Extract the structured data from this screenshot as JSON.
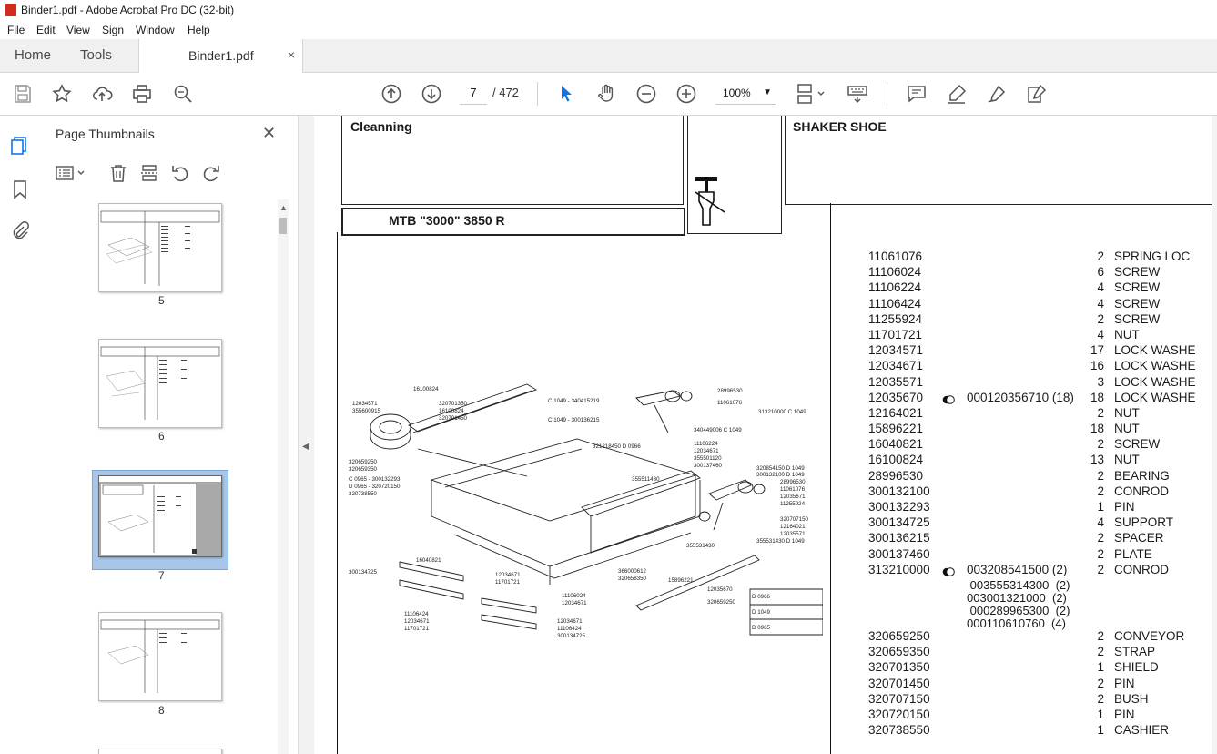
{
  "window": {
    "title": "Binder1.pdf - Adobe Acrobat Pro DC (32-bit)"
  },
  "menu": [
    "File",
    "Edit",
    "View",
    "Sign",
    "Window",
    "Help"
  ],
  "tabs": {
    "home": "Home",
    "tools": "Tools",
    "doc": "Binder1.pdf",
    "close": "×"
  },
  "toolbar": {
    "page_current": "7",
    "page_total": "/ 472",
    "zoom": "100%"
  },
  "sidebar": {
    "title": "Page Thumbnails",
    "thumbnails": [
      {
        "label": "5"
      },
      {
        "label": "6"
      },
      {
        "label": "7"
      },
      {
        "label": "8"
      }
    ],
    "selected_page": "7"
  },
  "document": {
    "section_title": "Cleanning",
    "model": "MTB \"3000\" 3850 R",
    "group_title": "SHAKER SHOE",
    "parts": [
      {
        "pn": "11061076",
        "qty": "2",
        "desc": "SPRING LOC"
      },
      {
        "pn": "11106024",
        "qty": "6",
        "desc": "SCREW"
      },
      {
        "pn": "11106224",
        "qty": "4",
        "desc": "SCREW"
      },
      {
        "pn": "11106424",
        "qty": "4",
        "desc": "SCREW"
      },
      {
        "pn": "11255924",
        "qty": "2",
        "desc": "SCREW"
      },
      {
        "pn": "11701721",
        "qty": "4",
        "desc": "NUT"
      },
      {
        "pn": "12034571",
        "qty": "17",
        "desc": "LOCK WASHE"
      },
      {
        "pn": "12034671",
        "qty": "16",
        "desc": "LOCK WASHE"
      },
      {
        "pn": "12035571",
        "qty": "3",
        "desc": "LOCK WASHE"
      },
      {
        "pn": "12035670",
        "alt": "000120356710  (18)",
        "qty": "18",
        "desc": "LOCK WASHE"
      },
      {
        "pn": "12164021",
        "qty": "2",
        "desc": "NUT"
      },
      {
        "pn": "15896221",
        "qty": "18",
        "desc": "NUT"
      },
      {
        "pn": "16040821",
        "qty": "2",
        "desc": "SCREW"
      },
      {
        "pn": "16100824",
        "qty": "13",
        "desc": "NUT"
      },
      {
        "pn": "28996530",
        "qty": "2",
        "desc": "BEARING"
      },
      {
        "pn": "300132100",
        "qty": "2",
        "desc": "CONROD"
      },
      {
        "pn": "300132293",
        "qty": "1",
        "desc": "PIN"
      },
      {
        "pn": "300134725",
        "qty": "4",
        "desc": "SUPPORT"
      },
      {
        "pn": "300136215",
        "qty": "2",
        "desc": "SPACER"
      },
      {
        "pn": "300137460",
        "qty": "2",
        "desc": "PLATE"
      },
      {
        "pn": "313210000",
        "alt": "003208541500  (2)",
        "qty": "2",
        "desc": "CONROD"
      }
    ],
    "alternates": [
      " 003555314300  (2)",
      "003001321000  (2)",
      " 000289965300  (2)",
      "000110610760  (4)"
    ],
    "parts2": [
      {
        "pn": "320659250",
        "qty": "2",
        "desc": "CONVEYOR"
      },
      {
        "pn": "320659350",
        "qty": "2",
        "desc": "STRAP"
      },
      {
        "pn": "320701350",
        "qty": "1",
        "desc": "SHIELD"
      },
      {
        "pn": "320701450",
        "qty": "2",
        "desc": "PIN"
      },
      {
        "pn": "320707150",
        "qty": "2",
        "desc": "BUSH"
      },
      {
        "pn": "320720150",
        "qty": "1",
        "desc": "PIN"
      },
      {
        "pn": "320738550",
        "qty": "1",
        "desc": "CASHIER"
      }
    ],
    "diagram_labels": {
      "a": "16100824",
      "b": "12034571",
      "c": "355600915",
      "d": "320701350",
      "e": "16100824",
      "f": "320701450",
      "g": "C 1049 - 340415219",
      "h": "C 1049 - 300136215",
      "i": "28996530",
      "j": "11061076",
      "k": "313210000 C 1049",
      "l": "340449006 C 1049",
      "m": "320659250",
      "n": "320659350",
      "o": "C 0965 - 300132293",
      "p": "D 0965 - 320720150",
      "q": "320738550",
      "r": "321218450 D 0966",
      "s": "11106224",
      "t": "12034671",
      "u": "355501120",
      "v": "300137460",
      "w": "355511430",
      "x": "320854150 D 1049",
      "y": "300132100 D 1049",
      "z": "28996530",
      "a2": "11061076",
      "b2": "12035671",
      "c2": "11255924",
      "d2": "320707150",
      "e2": "12164021",
      "f2": "12035571",
      "g2": "355531430 D 1049",
      "h2": "355531430",
      "i2": "16040821",
      "j2": "300134725",
      "k2": "12034671",
      "l2": "11701721",
      "m2": "11106024",
      "n2": "12034671",
      "o2": "366000612",
      "p2": "15896221",
      "q2": "320658350",
      "r2": "12035670",
      "s2": "320659250",
      "t2": "11106424",
      "u2": "12034671",
      "v2": "11701721",
      "w2": "12034671",
      "x2": "11106424",
      "y2": "300134725",
      "leg1": "D 0966",
      "leg2": "D 1049",
      "leg3": "D 0965"
    }
  }
}
